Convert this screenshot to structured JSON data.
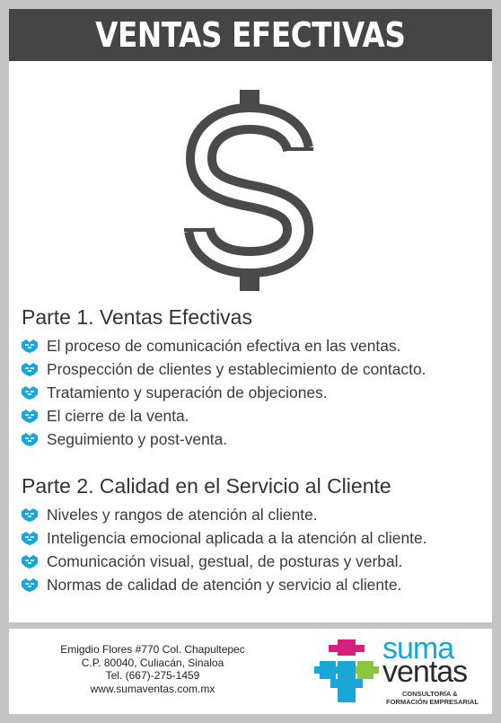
{
  "header": {
    "title": "VENTAS EFECTIVAS"
  },
  "icons": {
    "main": "dollar-sign-icon",
    "bullet": "handshake-icon"
  },
  "colors": {
    "header_bg": "#454545",
    "bullet": "#1aa7d8",
    "text": "#333333",
    "logo_blue": "#1aa7d8",
    "logo_magenta": "#d6207f",
    "logo_green": "#8cc63f"
  },
  "part1": {
    "title": "Parte 1. Ventas Efectivas",
    "items": [
      "El proceso de comunicación efectiva en las ventas.",
      "Prospección de clientes y establecimiento de contacto.",
      "Tratamiento y superación de objeciones.",
      "El cierre de la venta.",
      "Seguimiento y post-venta."
    ]
  },
  "part2": {
    "title": "Parte 2. Calidad en el Servicio al Cliente",
    "items": [
      "Niveles y rangos de atención al cliente.",
      "Inteligencia emocional aplicada a la atención al cliente.",
      "Comunicación visual, gestual, de posturas y verbal.",
      "Normas de calidad de atención y servicio al cliente."
    ]
  },
  "footer": {
    "address": [
      "Emigdio Flores #770 Col. Chapultepec",
      "C.P. 80040, Culiacán, Sinaloa",
      "Tel. (667)-275-1459",
      "www.sumaventas.com.mx"
    ],
    "logo": {
      "word1": "suma",
      "word2": "ventas",
      "tagline1": "CONSULTORÍA &",
      "tagline2": "FORMACIÓN EMPRESARIAL"
    }
  }
}
